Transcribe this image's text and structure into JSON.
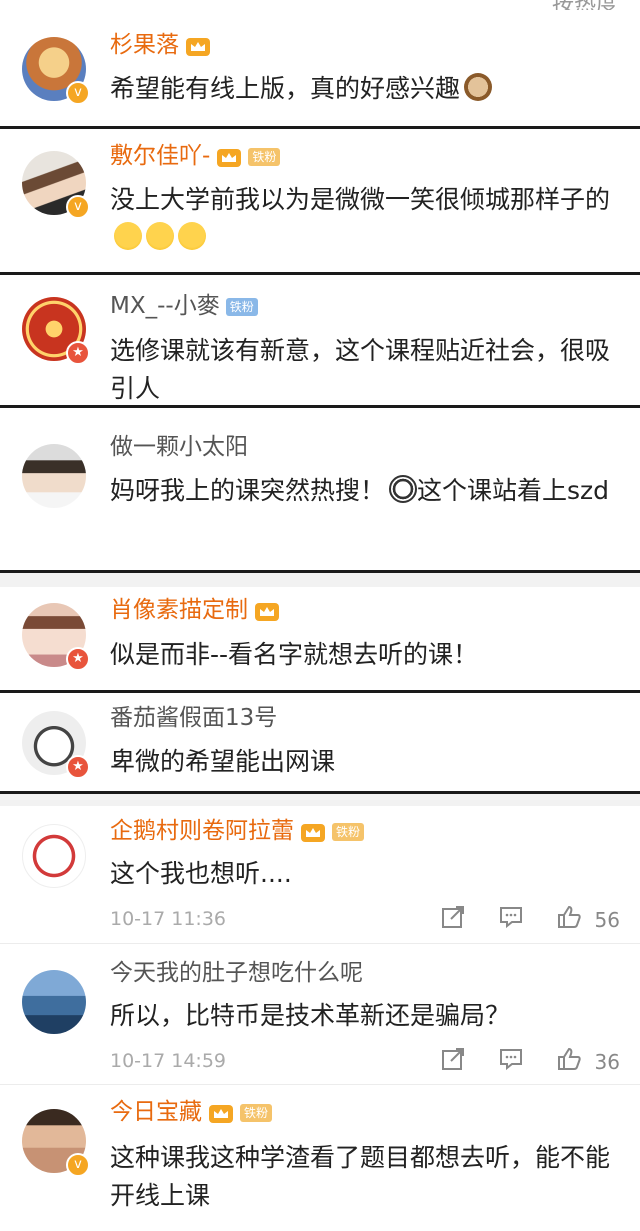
{
  "top_right_text": "按热度",
  "colors": {
    "name_orange": "#e86a0f",
    "divider": "#1a1a1a"
  },
  "comments": [
    {
      "name": "杉果落",
      "name_style": "orange",
      "crown": true,
      "fan": "",
      "avatar_badge": "v",
      "text": "希望能有线上版，真的好感兴趣",
      "emoji": "monkey"
    },
    {
      "name": "敷尔佳吖-",
      "name_style": "orange",
      "crown": true,
      "fan": "铁粉",
      "avatar_badge": "v",
      "text": "没上大学前我以为是微微一笑很倾城那样子的",
      "emoji": "cry"
    },
    {
      "name": "MX_--小麥",
      "name_style": "gray",
      "crown": false,
      "fan": "铁粉",
      "avatar_badge": "star",
      "text": "选修课就该有新意，这个课程贴近社会，很吸引人"
    },
    {
      "name": "做一颗小太阳",
      "name_style": "gray",
      "crown": false,
      "fan": "",
      "avatar_badge": "",
      "text_a": "妈呀我上的课突然热搜！",
      "text_b": "这个课站着上szd",
      "emoji": "panda"
    },
    {
      "name": "肖像素描定制",
      "name_style": "orange",
      "crown": true,
      "fan": "",
      "avatar_badge": "star",
      "text": "似是而非--看名字就想去听的课！"
    },
    {
      "name": "番茄酱假面13号",
      "name_style": "gray",
      "crown": false,
      "fan": "",
      "avatar_badge": "star",
      "text": "卑微的希望能出网课"
    },
    {
      "name": "企鹅村则卷阿拉蕾",
      "name_style": "orange",
      "crown": true,
      "fan": "铁粉",
      "avatar_badge": "",
      "text": "这个我也想听....",
      "time": "10-17 11:36",
      "likes": "56"
    },
    {
      "name": "今天我的肚子想吃什么呢",
      "name_style": "gray",
      "crown": false,
      "fan": "",
      "avatar_badge": "",
      "text": "所以，比特币是技术革新还是骗局？",
      "time": "10-17 14:59",
      "likes": "36"
    },
    {
      "name": "今日宝藏",
      "name_style": "orange",
      "crown": true,
      "fan": "铁粉",
      "avatar_badge": "v",
      "text": "这种课我这种学渣看了题目都想去听，能不能开线上课"
    }
  ]
}
